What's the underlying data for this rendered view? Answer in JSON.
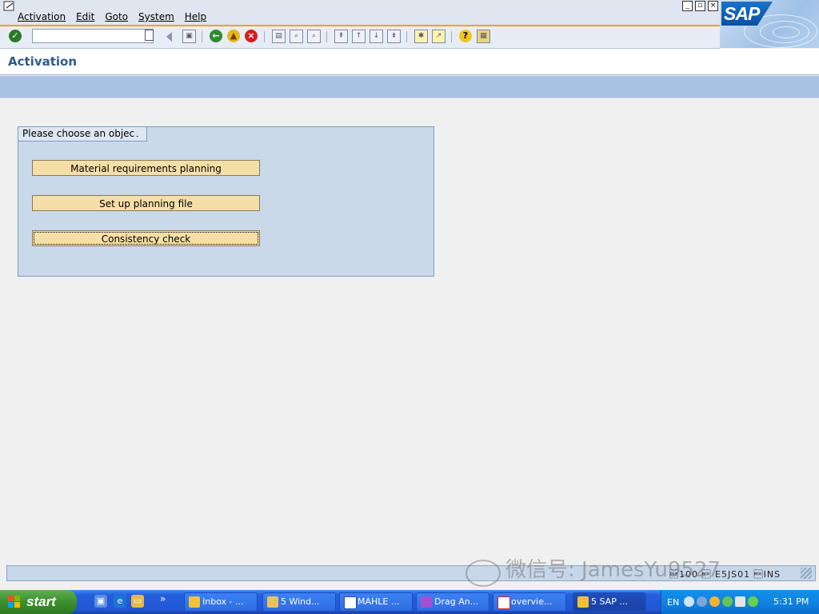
{
  "menu": {
    "items": [
      "Activation",
      "Edit",
      "Goto",
      "System",
      "Help"
    ]
  },
  "window_controls": {
    "minimize": "_",
    "restore": "▫",
    "close": "×"
  },
  "logo": {
    "text": "SAP"
  },
  "toolbar": {
    "command_field_value": "",
    "icons": [
      "enter-icon",
      "back-icon",
      "exit-icon",
      "cancel-icon",
      "print-icon",
      "find-icon",
      "find-next-icon",
      "first-page-icon",
      "previous-page-icon",
      "next-page-icon",
      "last-page-icon",
      "create-session-icon",
      "shortcut-icon",
      "help-icon",
      "layout-icon"
    ]
  },
  "page": {
    "title": "Activation"
  },
  "group": {
    "title": "Please choose an object",
    "buttons": [
      "Material requirements planning",
      "Set up planning file",
      "Consistency check"
    ]
  },
  "status": {
    "info": "\u0010100 \u0006 E5JS01 \u0006INS"
  },
  "watermark": {
    "text": "微信号: JamesYu9527"
  },
  "taskbar": {
    "start_label": "start",
    "quick_launch_more": "»",
    "tasks": [
      "Inbox - ...",
      "5 Wind...",
      "MAHLE ...",
      "Drag An...",
      "overvie...",
      "5 SAP ..."
    ],
    "lang": "EN",
    "clock": "5:31 PM"
  },
  "colors": {
    "accent_orange": "#f0a030",
    "title_blue": "#2e5b86",
    "button_fill": "#f5dfa8",
    "group_fill": "#cad9ea"
  }
}
